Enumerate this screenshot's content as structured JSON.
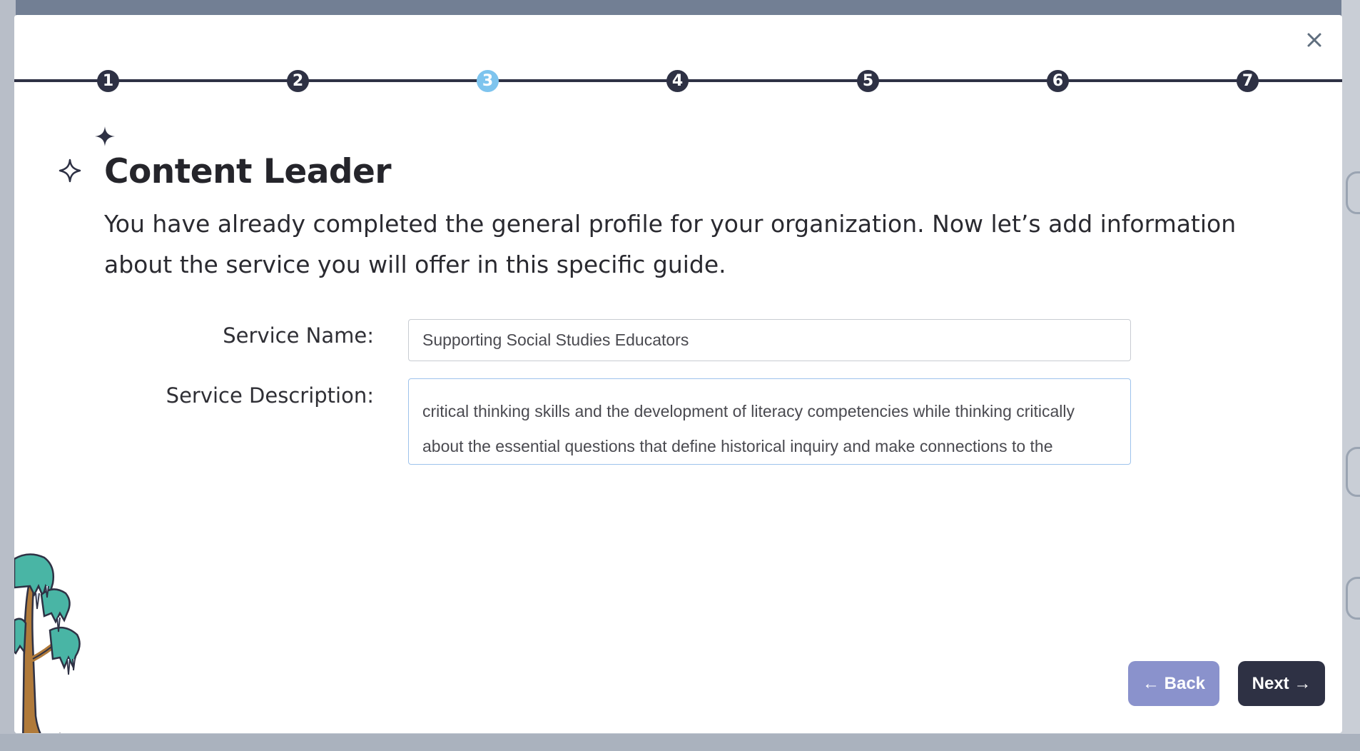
{
  "modal": {
    "close_icon": "close-icon",
    "steps": [
      "1",
      "2",
      "3",
      "4",
      "5",
      "6",
      "7"
    ],
    "active_step": 3,
    "title": "Content Leader",
    "intro": "You have already completed the general profile for your organization. Now let’s add information about the service you will offer in this specific guide.",
    "form": {
      "service_name_label": "Service Name:",
      "service_name_value": "Supporting Social Studies Educators",
      "service_description_label": "Service Description:",
      "service_description_lines": [
        "critical thinking skills and the development of literacy competencies while thinking critically",
        "about the essential questions that define historical inquiry and make connections to the"
      ]
    },
    "buttons": {
      "back": "← Back",
      "next": "Next →"
    }
  },
  "colors": {
    "navy": "#2e3144",
    "active_step": "#7ec4ee",
    "back_button": "#8a92cc",
    "tree_foliage": "#49b5a5",
    "tree_trunk": "#b07a3a"
  },
  "icons": {
    "sparkle_filled": "sparkle-filled-icon",
    "sparkle_outline": "sparkle-outline-icon",
    "tree": "tree-illustration"
  }
}
